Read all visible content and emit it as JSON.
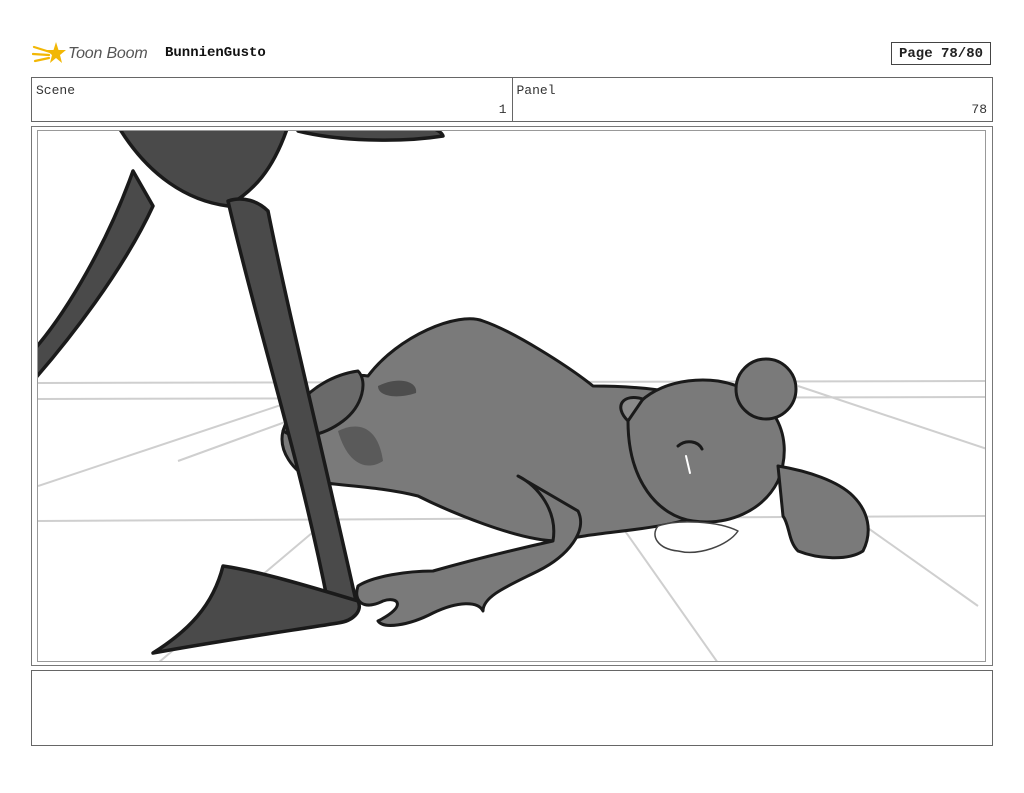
{
  "header": {
    "logo_text": "Toon Boom",
    "project_name": "BunnienGusto",
    "page_label": "Page 78/80"
  },
  "info": {
    "scene_label": "Scene",
    "scene_value": "1",
    "panel_label": "Panel",
    "panel_value": "78"
  },
  "notes": {
    "text": ""
  },
  "colors": {
    "logo_accent": "#f2b705",
    "sketch_dark": "#4a4a4a",
    "sketch_mid": "#7a7a7a",
    "line": "#1a1a1a"
  }
}
